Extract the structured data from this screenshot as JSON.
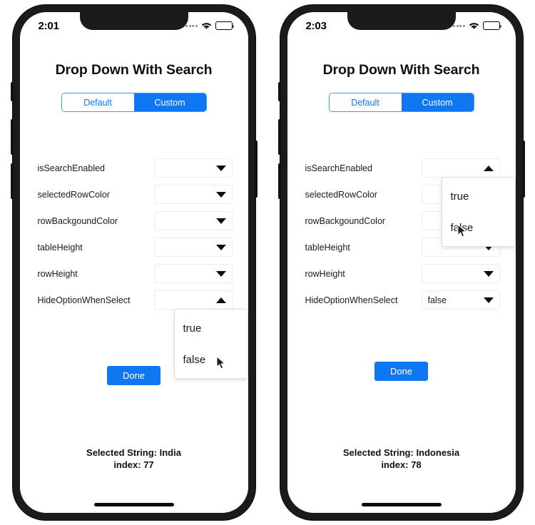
{
  "meta": {
    "accent_blue": "#1077f2",
    "frame_color": "#1b1b1b",
    "screen_bg": "#ffffff"
  },
  "phones": [
    {
      "id": "left",
      "status_bar": {
        "clock": "2:01",
        "signal_icon": "signal-dots-icon",
        "wifi_icon": "wifi-icon",
        "battery_icon": "battery-icon"
      },
      "app": {
        "title": "Drop Down With Search",
        "segmented": {
          "options": [
            "Default",
            "Custom"
          ],
          "selected": "Custom"
        },
        "rows": [
          {
            "label": "isSearchEnabled",
            "value": "",
            "caret": "down",
            "open": false
          },
          {
            "label": "selectedRowColor",
            "value": "",
            "caret": "down",
            "open": false
          },
          {
            "label": "rowBackgoundColor",
            "value": "",
            "caret": "down",
            "open": false
          },
          {
            "label": "tableHeight",
            "value": "",
            "caret": "down",
            "open": false
          },
          {
            "label": "rowHeight",
            "value": "",
            "caret": "down",
            "open": false
          },
          {
            "label": "HideOptionWhenSelect",
            "value": "",
            "caret": "up",
            "open": true
          }
        ],
        "dropdown_options": [
          "true",
          "false"
        ],
        "open_row_index": 5,
        "cursor_on_option": "false",
        "done_label": "Done",
        "footer": {
          "selected_line": "Selected String: India",
          "index_line": "index: 77"
        }
      }
    },
    {
      "id": "right",
      "status_bar": {
        "clock": "2:03",
        "signal_icon": "signal-dots-icon",
        "wifi_icon": "wifi-icon",
        "battery_icon": "battery-icon"
      },
      "app": {
        "title": "Drop Down With Search",
        "segmented": {
          "options": [
            "Default",
            "Custom"
          ],
          "selected": "Custom"
        },
        "rows": [
          {
            "label": "isSearchEnabled",
            "value": "",
            "caret": "up",
            "open": true
          },
          {
            "label": "selectedRowColor",
            "value": "",
            "caret": "down",
            "open": false
          },
          {
            "label": "rowBackgoundColor",
            "value": "",
            "caret": "down",
            "open": false
          },
          {
            "label": "tableHeight",
            "value": "",
            "caret": "down",
            "open": false
          },
          {
            "label": "rowHeight",
            "value": "",
            "caret": "down",
            "open": false
          },
          {
            "label": "HideOptionWhenSelect",
            "value": "false",
            "caret": "down",
            "open": false
          }
        ],
        "dropdown_options": [
          "true",
          "false"
        ],
        "open_row_index": 0,
        "cursor_on_option": "false",
        "done_label": "Done",
        "footer": {
          "selected_line": "Selected String: Indonesia",
          "index_line": "index: 78"
        }
      }
    }
  ]
}
